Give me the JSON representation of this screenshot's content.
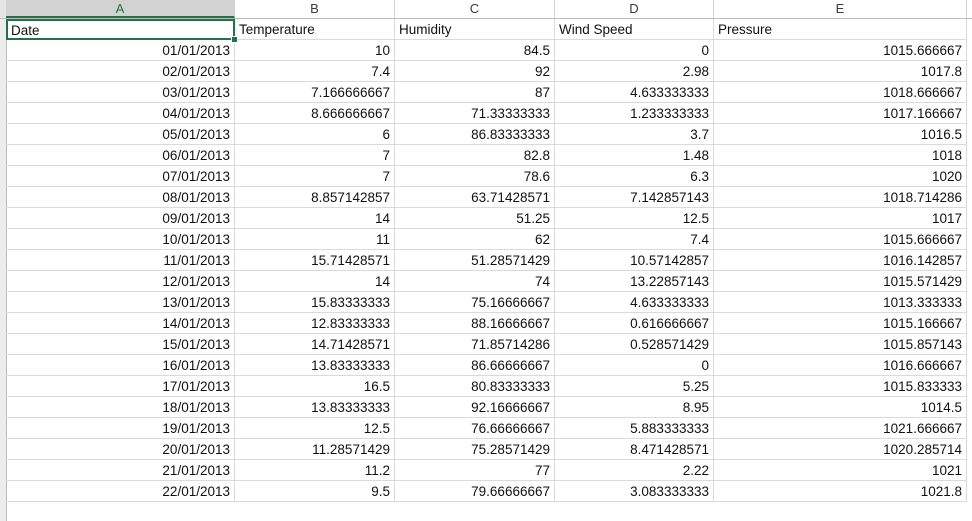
{
  "sheet": {
    "columns": [
      "A",
      "B",
      "C",
      "D",
      "E"
    ],
    "header_row": [
      "Date",
      "Temperature",
      "Humidity",
      "Wind Speed",
      "Pressure"
    ],
    "rows": [
      [
        "01/01/2013",
        "10",
        "84.5",
        "0",
        "1015.666667"
      ],
      [
        "02/01/2013",
        "7.4",
        "92",
        "2.98",
        "1017.8"
      ],
      [
        "03/01/2013",
        "7.166666667",
        "87",
        "4.633333333",
        "1018.666667"
      ],
      [
        "04/01/2013",
        "8.666666667",
        "71.33333333",
        "1.233333333",
        "1017.166667"
      ],
      [
        "05/01/2013",
        "6",
        "86.83333333",
        "3.7",
        "1016.5"
      ],
      [
        "06/01/2013",
        "7",
        "82.8",
        "1.48",
        "1018"
      ],
      [
        "07/01/2013",
        "7",
        "78.6",
        "6.3",
        "1020"
      ],
      [
        "08/01/2013",
        "8.857142857",
        "63.71428571",
        "7.142857143",
        "1018.714286"
      ],
      [
        "09/01/2013",
        "14",
        "51.25",
        "12.5",
        "1017"
      ],
      [
        "10/01/2013",
        "11",
        "62",
        "7.4",
        "1015.666667"
      ],
      [
        "11/01/2013",
        "15.71428571",
        "51.28571429",
        "10.57142857",
        "1016.142857"
      ],
      [
        "12/01/2013",
        "14",
        "74",
        "13.22857143",
        "1015.571429"
      ],
      [
        "13/01/2013",
        "15.83333333",
        "75.16666667",
        "4.633333333",
        "1013.333333"
      ],
      [
        "14/01/2013",
        "12.83333333",
        "88.16666667",
        "0.616666667",
        "1015.166667"
      ],
      [
        "15/01/2013",
        "14.71428571",
        "71.85714286",
        "0.528571429",
        "1015.857143"
      ],
      [
        "16/01/2013",
        "13.83333333",
        "86.66666667",
        "0",
        "1016.666667"
      ],
      [
        "17/01/2013",
        "16.5",
        "80.83333333",
        "5.25",
        "1015.833333"
      ],
      [
        "18/01/2013",
        "13.83333333",
        "92.16666667",
        "8.95",
        "1014.5"
      ],
      [
        "19/01/2013",
        "12.5",
        "76.66666667",
        "5.883333333",
        "1021.666667"
      ],
      [
        "20/01/2013",
        "11.28571429",
        "75.28571429",
        "8.471428571",
        "1020.285714"
      ],
      [
        "21/01/2013",
        "11.2",
        "77",
        "2.22",
        "1021"
      ],
      [
        "22/01/2013",
        "9.5",
        "79.66666667",
        "3.083333333",
        "1021.8"
      ]
    ],
    "selected_cell": "A1",
    "accent_color": "#217346"
  }
}
